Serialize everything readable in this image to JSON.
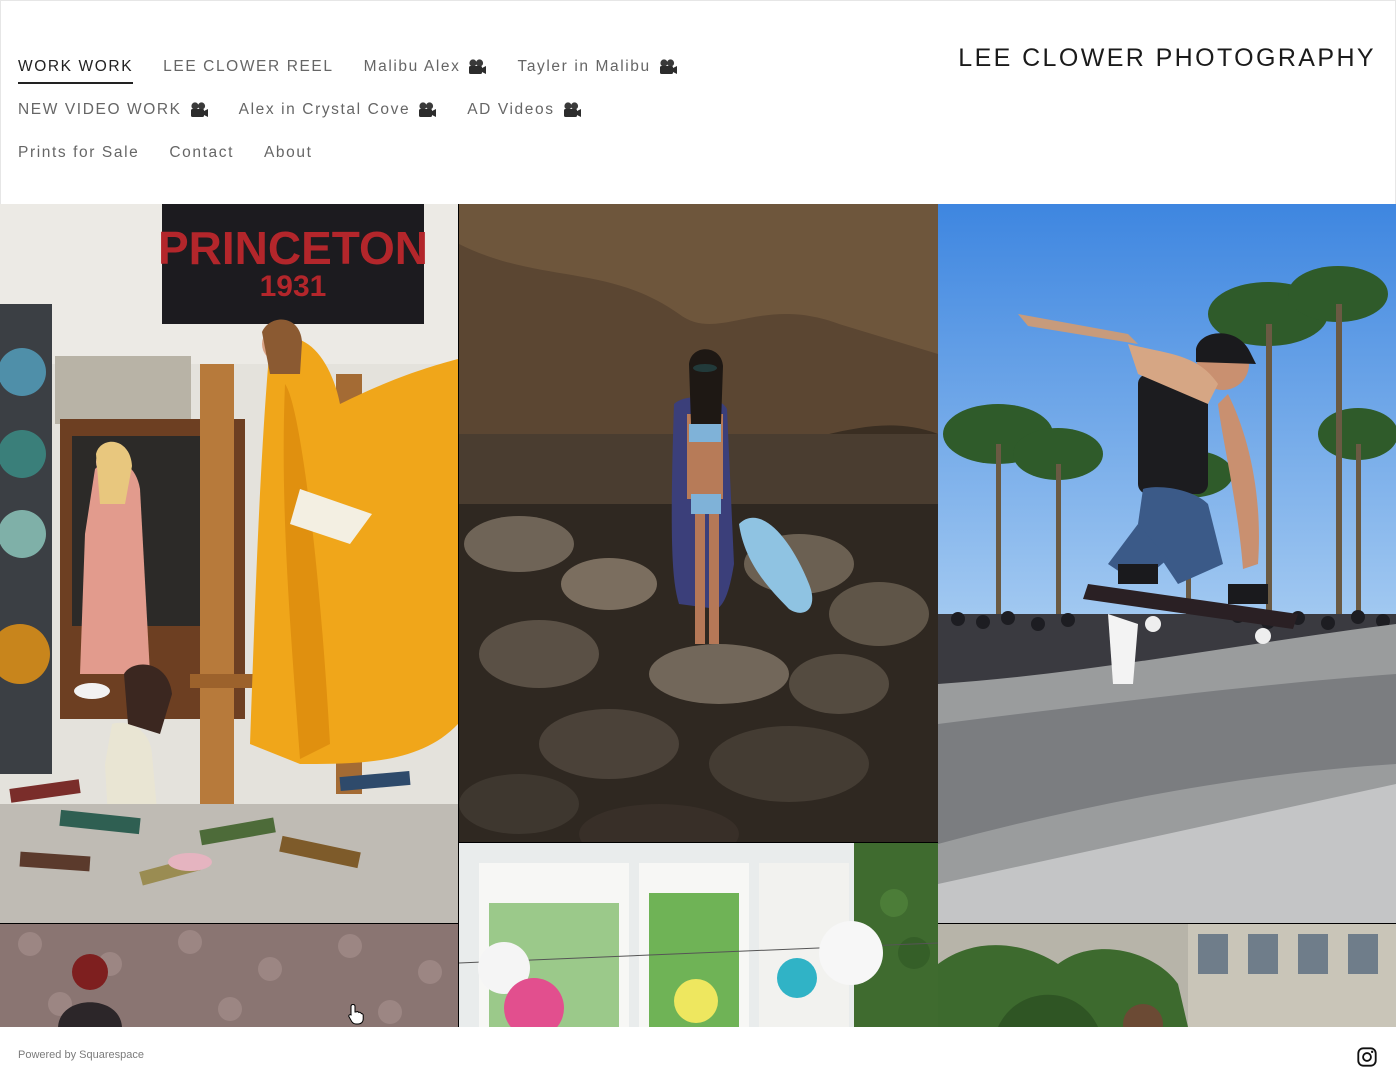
{
  "site": {
    "title": "LEE CLOWER PHOTOGRAPHY"
  },
  "nav": {
    "rows": [
      [
        {
          "label": "WORK WORK",
          "active": true,
          "icon": ""
        },
        {
          "label": "LEE CLOWER REEL",
          "active": false,
          "icon": ""
        },
        {
          "label": "Malibu Alex",
          "active": false,
          "icon": "movie-camera-icon"
        },
        {
          "label": "Tayler in Malibu",
          "active": false,
          "icon": "movie-camera-icon"
        }
      ],
      [
        {
          "label": "NEW VIDEO WORK",
          "active": false,
          "icon": "movie-camera-icon"
        },
        {
          "label": "Alex in Crystal Cove",
          "active": false,
          "icon": "movie-camera-icon"
        },
        {
          "label": "AD Videos",
          "active": false,
          "icon": "movie-camera-icon"
        }
      ],
      [
        {
          "label": "Prints for Sale",
          "active": false,
          "icon": ""
        },
        {
          "label": "Contact",
          "active": false,
          "icon": ""
        },
        {
          "label": "About",
          "active": false,
          "icon": ""
        }
      ]
    ]
  },
  "gallery": {
    "tiles": [
      {
        "name": "gallery-image-library-yellow-dress",
        "banner_line1": "PRINCETON",
        "banner_line2": "1931"
      },
      {
        "name": "gallery-image-beach-rocks-surfboard"
      },
      {
        "name": "gallery-image-skateboarder-venice"
      },
      {
        "name": "gallery-image-beanie-wallpaper"
      },
      {
        "name": "gallery-image-paper-lanterns"
      },
      {
        "name": "gallery-image-street-building"
      }
    ]
  },
  "footer": {
    "powered_by": "Powered by Squarespace",
    "social_icon": "instagram-icon"
  },
  "colors": {
    "text_dark": "#1b1b1b",
    "nav_text": "#666666",
    "background": "#ffffff"
  }
}
